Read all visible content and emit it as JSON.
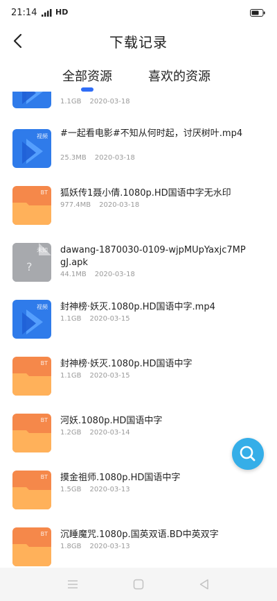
{
  "status_bar": {
    "time": "21:14",
    "network": "HD",
    "icons": [
      "signal-icon",
      "battery-icon"
    ]
  },
  "header": {
    "title": "下载记录",
    "back_icon": "chevron-left-icon"
  },
  "tabs": [
    {
      "label": "全部资源",
      "active": true
    },
    {
      "label": "喜欢的资源",
      "active": false
    }
  ],
  "colors": {
    "accent": "#2f6df6",
    "video_thumb": "#2f7bea",
    "bt_thumb": "#f5884a",
    "unknown_thumb": "#a7a9ad",
    "fab": "#35aee8",
    "meta_text": "#9a9a9a"
  },
  "downloads": [
    {
      "type": "video",
      "badge": "",
      "name": "",
      "size": "1.1GB",
      "date": "2020-03-18"
    },
    {
      "type": "video",
      "badge": "视频",
      "name": "#一起看电影#不知从何时起，讨厌树叶.mp4",
      "size": "25.3MB",
      "date": "2020-03-18"
    },
    {
      "type": "bt",
      "badge": "BT",
      "name": "狐妖传1聂小倩.1080p.HD国语中字无水印",
      "size": "977.4MB",
      "date": "2020-03-18"
    },
    {
      "type": "unknown",
      "badge": "未知",
      "name": "dawang-1870030-0109-wjpMUpYaxjc7MPgJ.apk",
      "size": "44.1MB",
      "date": "2020-03-18"
    },
    {
      "type": "video",
      "badge": "视频",
      "name": "封神榜·妖灭.1080p.HD国语中字.mp4",
      "size": "1.1GB",
      "date": "2020-03-15"
    },
    {
      "type": "bt",
      "badge": "BT",
      "name": "封神榜·妖灭.1080p.HD国语中字",
      "size": "1.1GB",
      "date": "2020-03-15"
    },
    {
      "type": "bt",
      "badge": "BT",
      "name": "河妖.1080p.HD国语中字",
      "size": "1.2GB",
      "date": "2020-03-14"
    },
    {
      "type": "bt",
      "badge": "BT",
      "name": "摸金祖师.1080p.HD国语中字",
      "size": "1.5GB",
      "date": "2020-03-13"
    },
    {
      "type": "bt",
      "badge": "BT",
      "name": "沉睡魔咒.1080p.国英双语.BD中英双字",
      "size": "1.8GB",
      "date": "2020-03-13"
    }
  ],
  "fab": {
    "icon": "search-icon"
  },
  "nav_bar": {
    "icons": [
      "menu-icon",
      "home-icon",
      "back-icon"
    ]
  }
}
